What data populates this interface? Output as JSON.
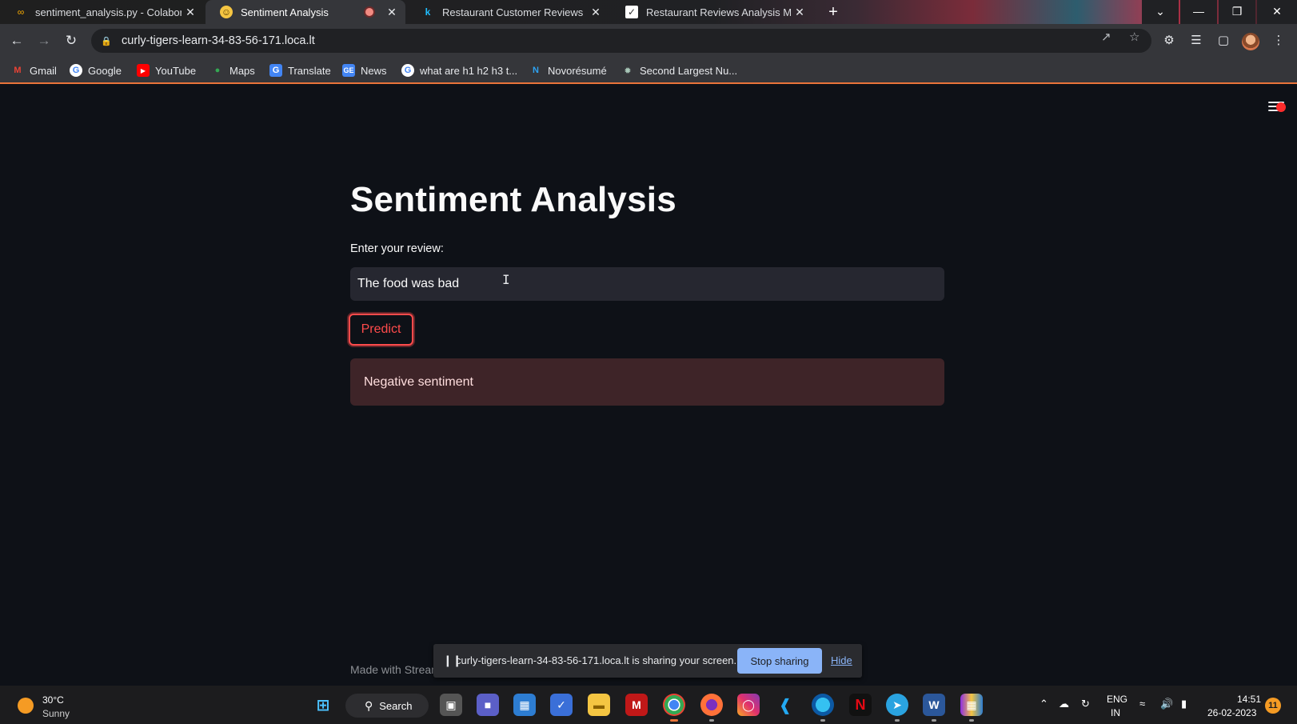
{
  "browser": {
    "tabs": [
      {
        "title": "sentiment_analysis.py - Colabora",
        "favicon": "colab-icon"
      },
      {
        "title": "Sentiment Analysis",
        "favicon": "smiley-icon"
      },
      {
        "title": "Restaurant Customer Reviews | K",
        "favicon": "kaggle-icon"
      },
      {
        "title": "Restaurant Reviews Analysis Mod",
        "favicon": "chart-icon"
      }
    ],
    "new_tab": "+",
    "address": "curly-tigers-learn-34-83-56-171.loca.lt",
    "bookmarks": [
      "Gmail",
      "Google",
      "YouTube",
      "Maps",
      "Translate",
      "News",
      "what are h1 h2 h3 t...",
      "Novorésumé",
      "Second Largest Nu..."
    ]
  },
  "app": {
    "title": "Sentiment Analysis",
    "input_label": "Enter your review:",
    "input_value": "The food was bad",
    "button_label": "Predict",
    "result": "Negative sentiment",
    "footer": "Made with Stream"
  },
  "share_bar": {
    "message": "curly-tigers-learn-34-83-56-171.loca.lt is sharing your screen.",
    "stop_label": "Stop sharing",
    "hide_label": "Hide"
  },
  "taskbar": {
    "temperature": "30°C",
    "condition": "Sunny",
    "search_label": "Search",
    "lang_top": "ENG",
    "lang_bottom": "IN",
    "time": "14:51",
    "date": "26-02-2023",
    "notification_count": "11"
  },
  "colors": {
    "app_bg": "#0e1117",
    "accent": "#ff4b4b",
    "error_bg": "#3e2428",
    "link": "#8ab4f8"
  }
}
